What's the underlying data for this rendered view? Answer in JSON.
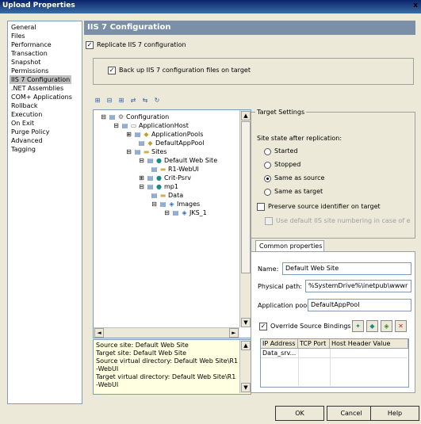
{
  "window": {
    "title": "Upload Properties",
    "close_label": "x"
  },
  "nav": {
    "items": [
      "General",
      "Files",
      "Performance",
      "Transaction",
      "Snapshot",
      "Permissions",
      "IIS 7 Configuration",
      ".NET Assemblies",
      "COM+ Applications",
      "Rollback",
      "Execution",
      "On Exit",
      "Purge Policy",
      "Advanced",
      "Tagging"
    ],
    "selected": "IIS 7 Configuration"
  },
  "header": {
    "title": "IIS 7 Configuration"
  },
  "replicate": {
    "label": "Replicate IIS 7 configuration",
    "checked": true
  },
  "backup": {
    "label": "Back up IIS 7 configuration files on target",
    "checked": true
  },
  "tree": {
    "nodes": [
      "Configuration",
      "ApplicationHost",
      "ApplicationPools",
      "DefaultAppPool",
      "Sites",
      "Default Web Site",
      "R1-WebUI",
      "Crit-Psrv",
      "mp1",
      "Data",
      "Images",
      "JKS_1"
    ]
  },
  "info": {
    "lines": [
      "Source site: Default Web Site",
      "Target site: Default Web Site",
      "Source virtual directory: Default Web Site\\R1",
      "-WebUI",
      "Target virtual directory: Default Web Site\\R1",
      "-WebUI"
    ]
  },
  "target_settings": {
    "title": "Target Settings",
    "site_state_label": "Site state after replication:",
    "options": [
      "Started",
      "Stopped",
      "Same as source",
      "Same as target"
    ],
    "selected_option": "Same as source",
    "preserve_label": "Preserve source identifier on target",
    "use_default_label": "Use default IIS site numbering in case of error"
  },
  "common": {
    "tab_label": "Common properties",
    "name_label": "Name:",
    "name_value": "Default Web Site",
    "path_label": "Physical path:",
    "path_value": "%SystemDrive%\\inetpub\\wwwr",
    "pool_label": "Application pool:",
    "pool_value": "DefaultAppPool",
    "override_label": "Override Source Bindings",
    "override_checked": true,
    "grid_headers": [
      "IP Address",
      "TCP Port",
      "Host Header Value"
    ],
    "grid_rows": [
      [
        "Data_srv...",
        "",
        ""
      ]
    ]
  },
  "buttons": {
    "ok": "OK",
    "cancel": "Cancel",
    "help": "Help"
  }
}
